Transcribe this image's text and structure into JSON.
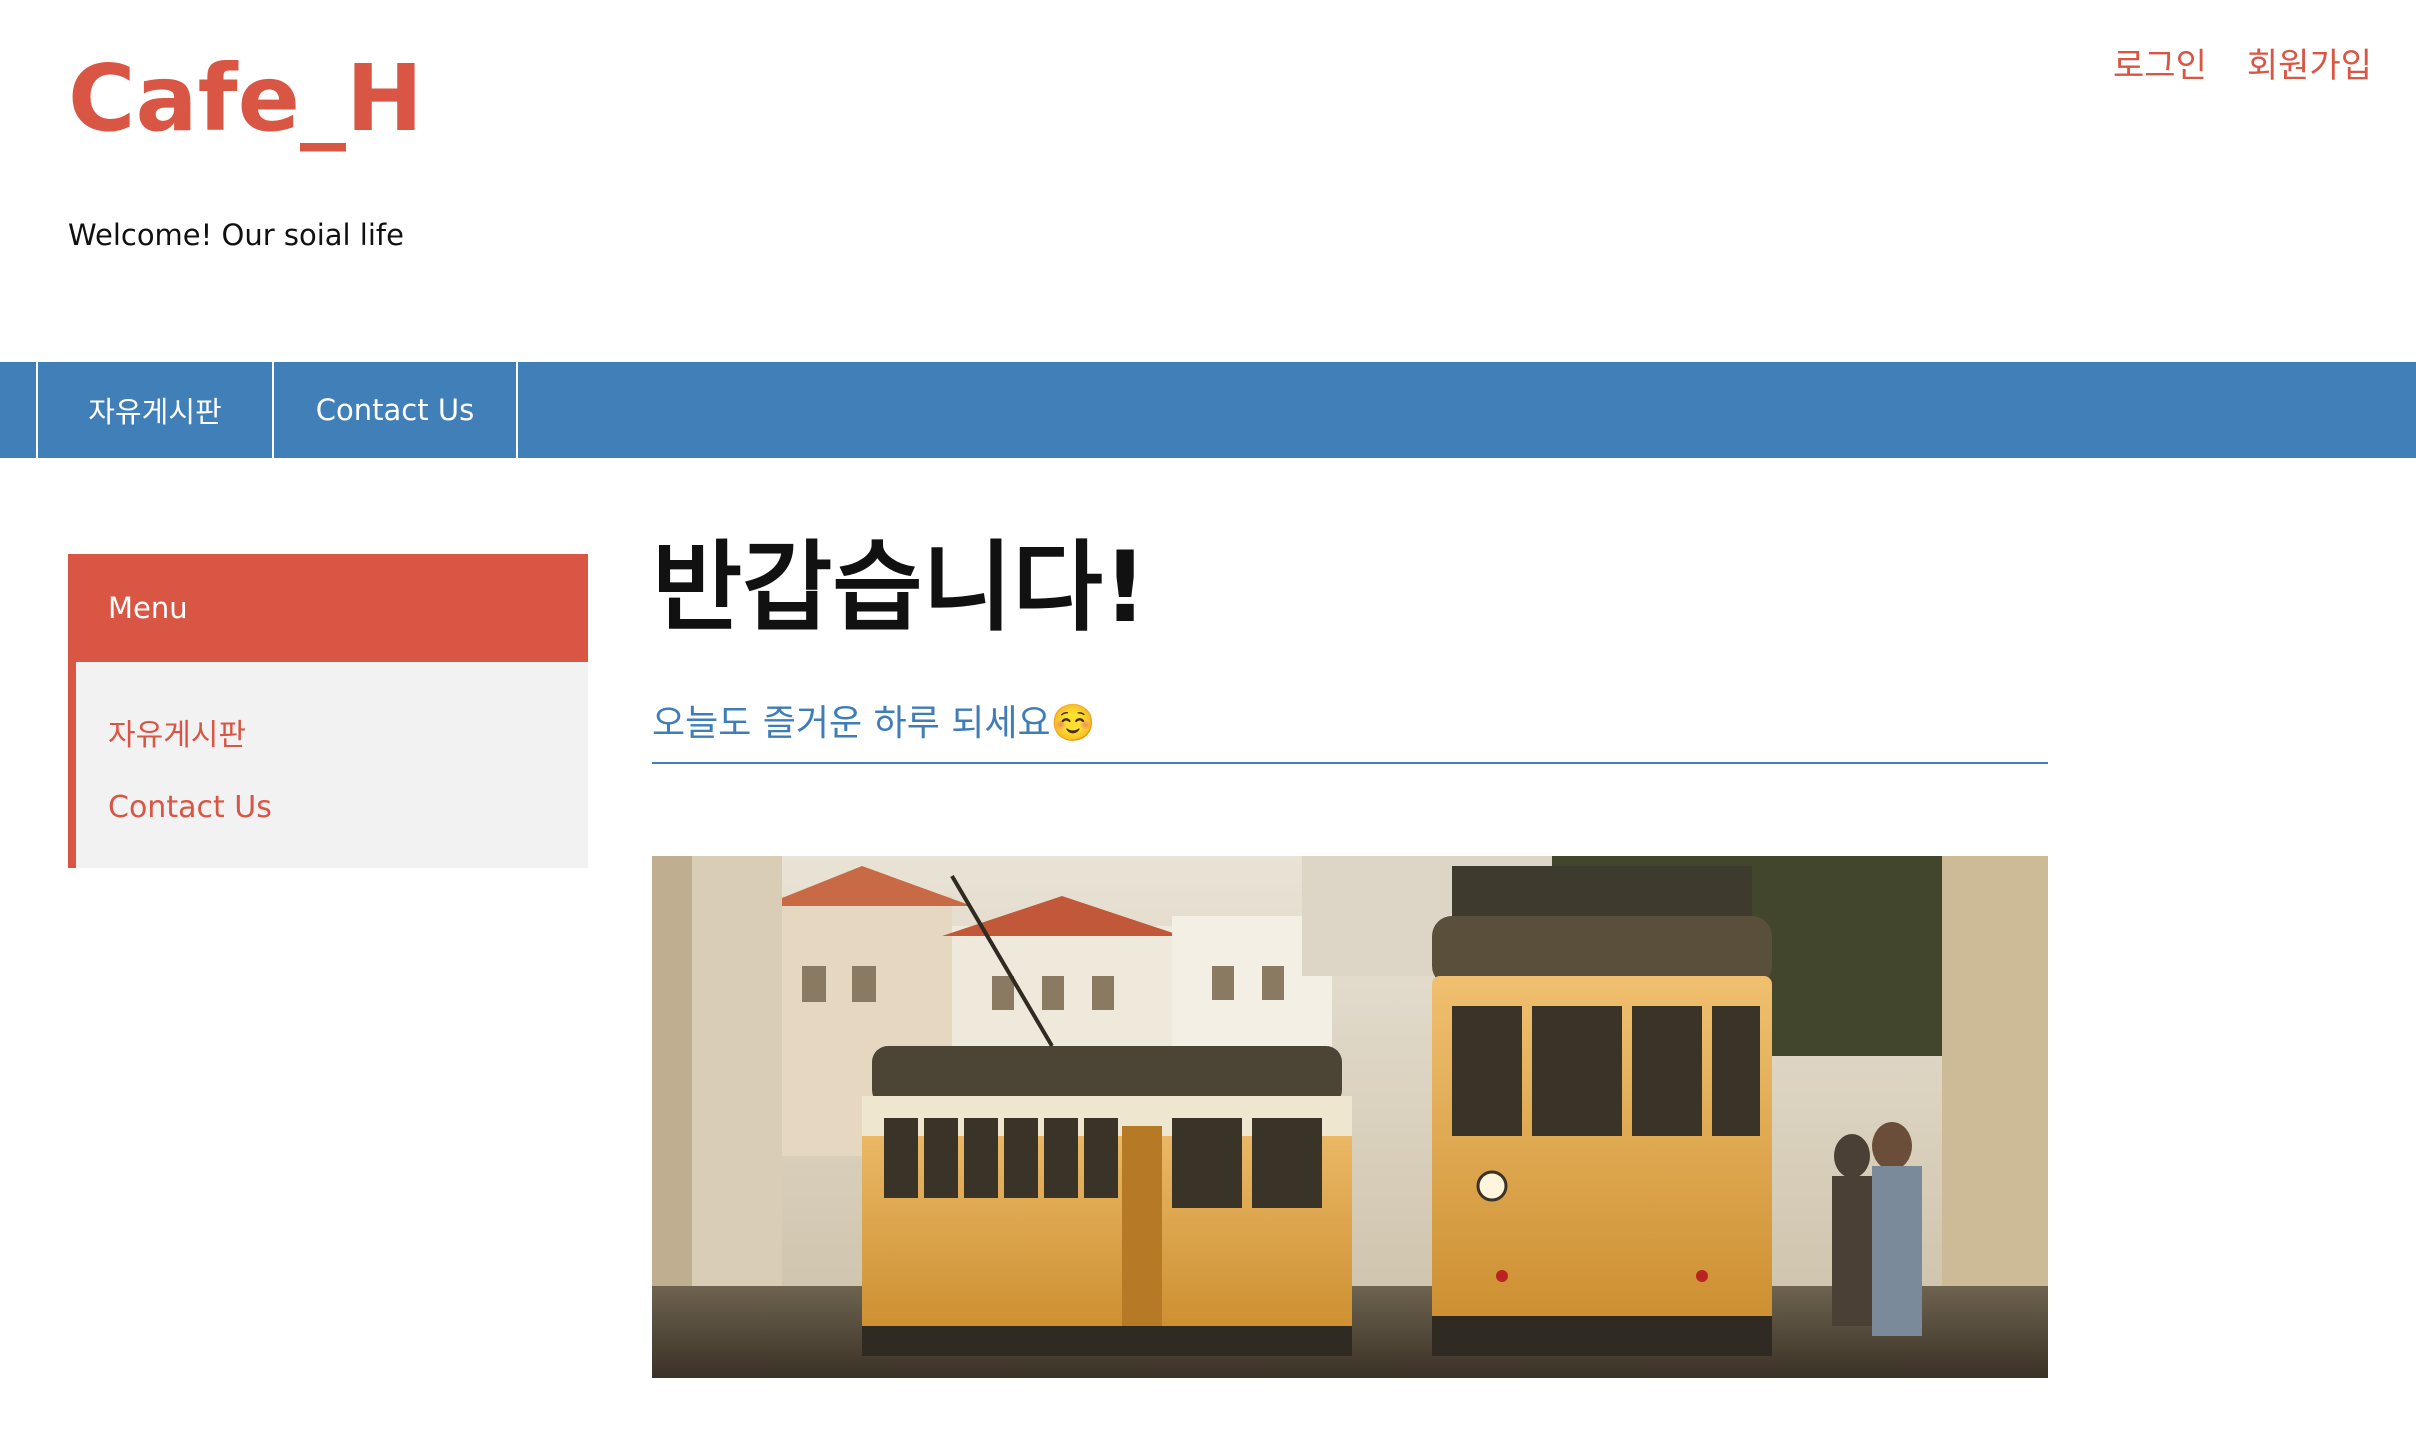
{
  "header": {
    "site_title": "Cafe_H",
    "tagline": "Welcome! Our soial life",
    "auth": {
      "login": "로그인",
      "signup": "회원가입"
    }
  },
  "navbar": {
    "items": [
      {
        "label": "자유게시판"
      },
      {
        "label": "Contact Us"
      }
    ]
  },
  "sidebar": {
    "title": "Menu",
    "items": [
      {
        "label": "자유게시판"
      },
      {
        "label": "Contact Us"
      }
    ]
  },
  "main": {
    "heading": "반갑습니다!",
    "subheading": "오늘도 즐거운 하루 되세요☺️"
  },
  "colors": {
    "accent": "#d95544",
    "nav": "#417fb8",
    "sidebar_bg": "#f2f2f2"
  }
}
